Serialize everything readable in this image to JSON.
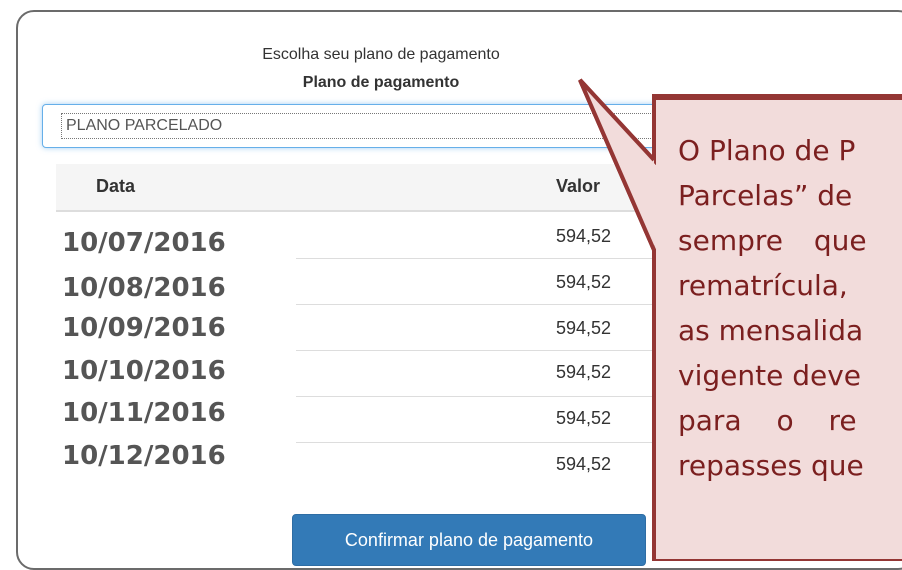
{
  "form": {
    "subtitle": "Escolha seu plano de pagamento",
    "title": "Plano de pagamento",
    "select_value": "PLANO PARCELADO"
  },
  "table": {
    "headers": {
      "date": "Data",
      "value": "Valor"
    },
    "rows": [
      {
        "date": "10/07/2016",
        "value": "594,52"
      },
      {
        "date": "10/08/2016",
        "value": "594,52"
      },
      {
        "date": "10/09/2016",
        "value": "594,52"
      },
      {
        "date": "10/10/2016",
        "value": "594,52"
      },
      {
        "date": "10/11/2016",
        "value": "594,52"
      },
      {
        "date": "10/12/2016",
        "value": "594,52"
      }
    ]
  },
  "confirm_button": "Confirmar plano de pagamento",
  "callout": {
    "lines": [
      "O Plano de P",
      "Parcelas” de",
      "sempre que",
      "rematrícula,",
      "as mensalida",
      "vigente deve",
      "para o re",
      "repasses que"
    ],
    "colors": {
      "fill": "#f2dcdb",
      "border": "#943634",
      "text": "#7b1f1f"
    }
  }
}
